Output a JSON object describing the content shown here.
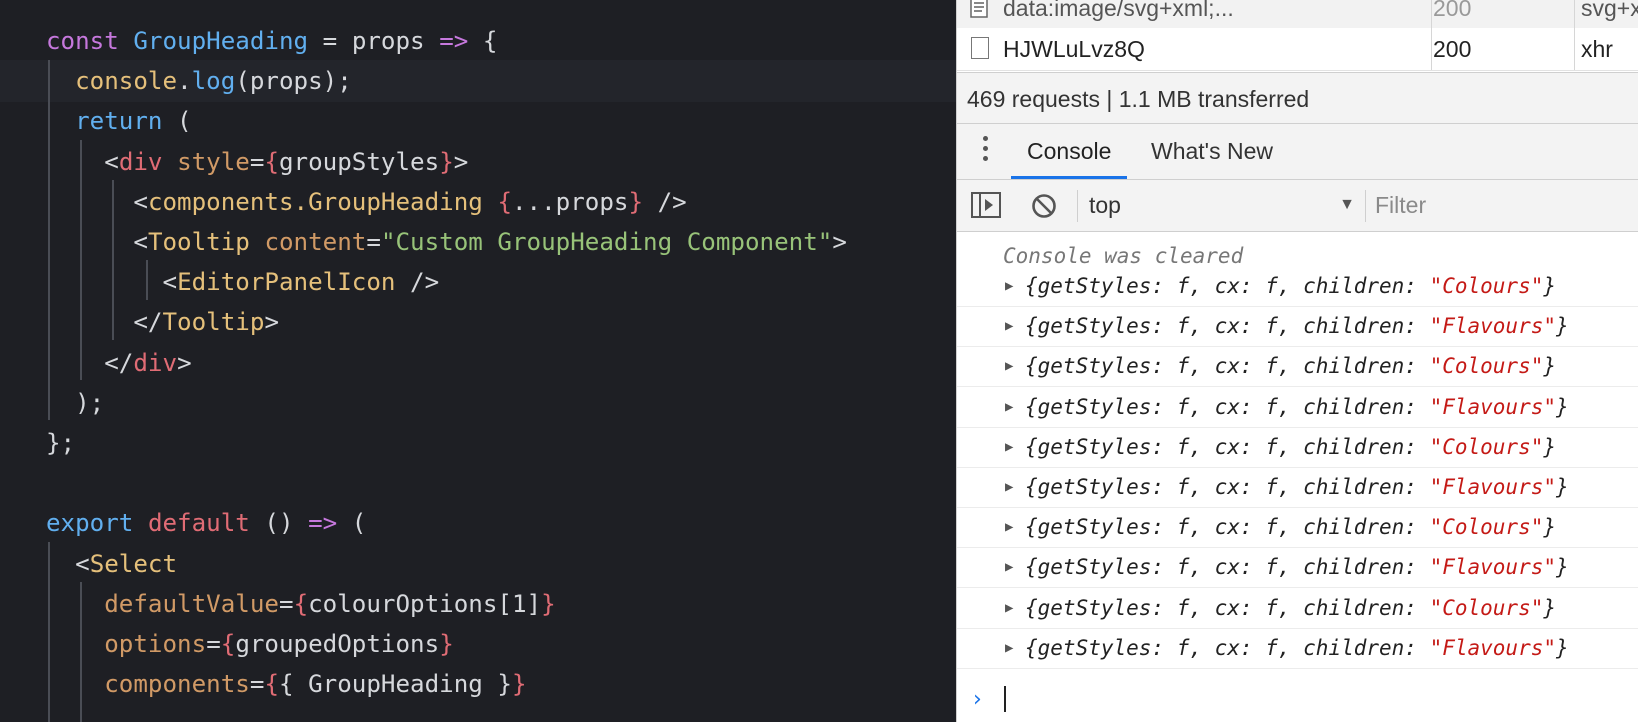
{
  "editor": {
    "lines": [
      [
        {
          "t": "const",
          "c": "t-kw"
        },
        {
          "t": " ",
          "c": "t-plain"
        },
        {
          "t": "GroupHeading",
          "c": "t-fn"
        },
        {
          "t": " = ",
          "c": "t-plain"
        },
        {
          "t": "props",
          "c": "t-plain"
        },
        {
          "t": " ",
          "c": "t-plain"
        },
        {
          "t": "=>",
          "c": "t-op"
        },
        {
          "t": " {",
          "c": "t-plain"
        }
      ],
      [
        {
          "t": "  ",
          "c": "t-plain"
        },
        {
          "t": "console",
          "c": "t-var"
        },
        {
          "t": ".",
          "c": "t-plain"
        },
        {
          "t": "log",
          "c": "t-method"
        },
        {
          "t": "(props);",
          "c": "t-plain"
        }
      ],
      [
        {
          "t": "  ",
          "c": "t-plain"
        },
        {
          "t": "return",
          "c": "t-fn"
        },
        {
          "t": " (",
          "c": "t-plain"
        }
      ],
      [
        {
          "t": "    <",
          "c": "t-plain"
        },
        {
          "t": "div",
          "c": "t-tagr"
        },
        {
          "t": " ",
          "c": "t-plain"
        },
        {
          "t": "style",
          "c": "t-attr"
        },
        {
          "t": "=",
          "c": "t-plain"
        },
        {
          "t": "{",
          "c": "t-brace"
        },
        {
          "t": "groupStyles",
          "c": "t-plain"
        },
        {
          "t": "}",
          "c": "t-brace"
        },
        {
          "t": ">",
          "c": "t-plain"
        }
      ],
      [
        {
          "t": "      <",
          "c": "t-plain"
        },
        {
          "t": "components.GroupHeading",
          "c": "t-tag"
        },
        {
          "t": " ",
          "c": "t-plain"
        },
        {
          "t": "{",
          "c": "t-brace"
        },
        {
          "t": "...props",
          "c": "t-plain"
        },
        {
          "t": "}",
          "c": "t-brace"
        },
        {
          "t": " />",
          "c": "t-plain"
        }
      ],
      [
        {
          "t": "      <",
          "c": "t-plain"
        },
        {
          "t": "Tooltip",
          "c": "t-tag"
        },
        {
          "t": " ",
          "c": "t-plain"
        },
        {
          "t": "content",
          "c": "t-attr"
        },
        {
          "t": "=",
          "c": "t-plain"
        },
        {
          "t": "\"Custom GroupHeading Component\"",
          "c": "t-str"
        },
        {
          "t": ">",
          "c": "t-plain"
        }
      ],
      [
        {
          "t": "        <",
          "c": "t-plain"
        },
        {
          "t": "EditorPanelIcon",
          "c": "t-tag"
        },
        {
          "t": " />",
          "c": "t-plain"
        }
      ],
      [
        {
          "t": "      </",
          "c": "t-plain"
        },
        {
          "t": "Tooltip",
          "c": "t-tag"
        },
        {
          "t": ">",
          "c": "t-plain"
        }
      ],
      [
        {
          "t": "    </",
          "c": "t-plain"
        },
        {
          "t": "div",
          "c": "t-tagr"
        },
        {
          "t": ">",
          "c": "t-plain"
        }
      ],
      [
        {
          "t": "  );",
          "c": "t-plain"
        }
      ],
      [
        {
          "t": "};",
          "c": "t-plain"
        }
      ],
      [],
      [
        {
          "t": "export",
          "c": "t-fn"
        },
        {
          "t": " ",
          "c": "t-plain"
        },
        {
          "t": "default",
          "c": "t-tagr"
        },
        {
          "t": " () ",
          "c": "t-plain"
        },
        {
          "t": "=>",
          "c": "t-op"
        },
        {
          "t": " (",
          "c": "t-plain"
        }
      ],
      [
        {
          "t": "  <",
          "c": "t-plain"
        },
        {
          "t": "Select",
          "c": "t-tag"
        }
      ],
      [
        {
          "t": "    ",
          "c": "t-plain"
        },
        {
          "t": "defaultValue",
          "c": "t-attr"
        },
        {
          "t": "=",
          "c": "t-plain"
        },
        {
          "t": "{",
          "c": "t-brace"
        },
        {
          "t": "colourOptions[1]",
          "c": "t-plain"
        },
        {
          "t": "}",
          "c": "t-brace"
        }
      ],
      [
        {
          "t": "    ",
          "c": "t-plain"
        },
        {
          "t": "options",
          "c": "t-attr"
        },
        {
          "t": "=",
          "c": "t-plain"
        },
        {
          "t": "{",
          "c": "t-brace"
        },
        {
          "t": "groupedOptions",
          "c": "t-plain"
        },
        {
          "t": "}",
          "c": "t-brace"
        }
      ],
      [
        {
          "t": "    ",
          "c": "t-plain"
        },
        {
          "t": "components",
          "c": "t-attr"
        },
        {
          "t": "=",
          "c": "t-plain"
        },
        {
          "t": "{",
          "c": "t-brace"
        },
        {
          "t": "{ GroupHeading }",
          "c": "t-plain"
        },
        {
          "t": "}",
          "c": "t-brace"
        }
      ]
    ]
  },
  "network": {
    "rows": [
      {
        "name": "data:image/svg+xml;...",
        "status": "200",
        "type": "svg+x"
      },
      {
        "name": "HJWLuLvz8Q",
        "status": "200",
        "type": "xhr"
      }
    ],
    "summary": "469 requests | 1.1 MB transferred"
  },
  "drawer": {
    "tabs": [
      {
        "label": "Console"
      },
      {
        "label": "What's New"
      }
    ]
  },
  "toolbar": {
    "context": "top",
    "filter_placeholder": "Filter"
  },
  "console": {
    "cleared_text": "Console was cleared",
    "messages": [
      {
        "prefix": "{getStyles: f, cx: f, children: ",
        "value": "\"Colours\"",
        "suffix": "}"
      },
      {
        "prefix": "{getStyles: f, cx: f, children: ",
        "value": "\"Flavours\"",
        "suffix": "}"
      },
      {
        "prefix": "{getStyles: f, cx: f, children: ",
        "value": "\"Colours\"",
        "suffix": "}"
      },
      {
        "prefix": "{getStyles: f, cx: f, children: ",
        "value": "\"Flavours\"",
        "suffix": "}"
      },
      {
        "prefix": "{getStyles: f, cx: f, children: ",
        "value": "\"Colours\"",
        "suffix": "}"
      },
      {
        "prefix": "{getStyles: f, cx: f, children: ",
        "value": "\"Flavours\"",
        "suffix": "}"
      },
      {
        "prefix": "{getStyles: f, cx: f, children: ",
        "value": "\"Colours\"",
        "suffix": "}"
      },
      {
        "prefix": "{getStyles: f, cx: f, children: ",
        "value": "\"Flavours\"",
        "suffix": "}"
      },
      {
        "prefix": "{getStyles: f, cx: f, children: ",
        "value": "\"Colours\"",
        "suffix": "}"
      },
      {
        "prefix": "{getStyles: f, cx: f, children: ",
        "value": "\"Flavours\"",
        "suffix": "}"
      }
    ]
  },
  "icons": {
    "sidebar": "sidebar-toggle-icon",
    "clear": "clear-console-icon",
    "menu": "kebab-menu-icon",
    "expand": "expand-triangle-icon",
    "prompt": "prompt-chevron-icon"
  },
  "colors": {
    "editor_bg": "#1e1f24",
    "accent": "#1a73e8",
    "string_red": "#c41a16"
  }
}
